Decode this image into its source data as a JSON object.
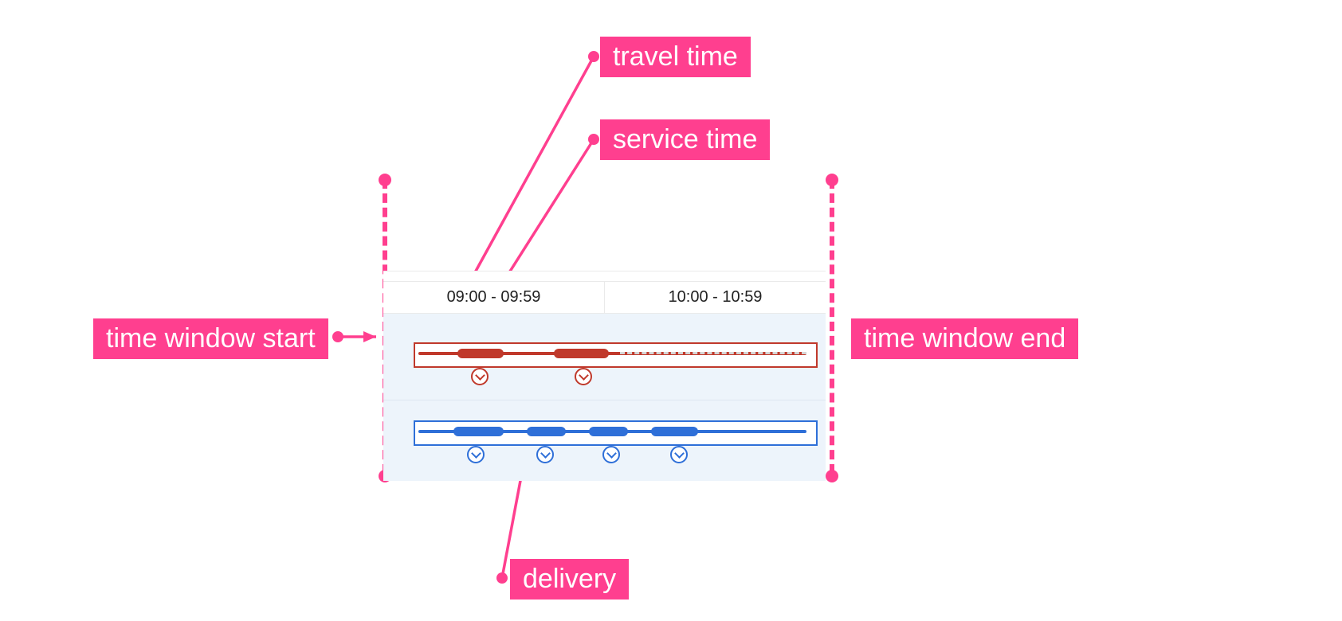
{
  "labels": {
    "travel_time": "travel time",
    "service_time": "service time",
    "time_window_start": "time window start",
    "time_window_end": "time window end",
    "delivery": "delivery"
  },
  "timeline": {
    "header": {
      "col1": "09:00 - 09:59",
      "col2": "10:00 - 10:59"
    }
  },
  "colors": {
    "pink": "#FF3F8F",
    "red": "#C0392B",
    "blue": "#2E6FD8",
    "pale": "#EDF4FB"
  },
  "diagram": {
    "description": "Annotated route timeline (Gantt-style) showing two vehicle rows. Thin line = travel time, thick segment = service time, circled chevron = delivery stop. Left/right dashed pink verticals mark time-window bounds.",
    "time_window": {
      "start_x_pct": 0,
      "end_x_pct": 100
    },
    "rows": [
      {
        "color": "red",
        "segments": [
          {
            "type": "travel",
            "start_pct": 0,
            "end_pct": 10
          },
          {
            "type": "service",
            "start_pct": 10,
            "end_pct": 22
          },
          {
            "type": "travel",
            "start_pct": 22,
            "end_pct": 35
          },
          {
            "type": "service",
            "start_pct": 35,
            "end_pct": 49
          }
        ],
        "stops_pct": [
          16,
          42
        ]
      },
      {
        "color": "blue",
        "segments": [
          {
            "type": "travel",
            "start_pct": 0,
            "end_pct": 9
          },
          {
            "type": "service",
            "start_pct": 9,
            "end_pct": 22
          },
          {
            "type": "travel",
            "start_pct": 22,
            "end_pct": 28
          },
          {
            "type": "service",
            "start_pct": 28,
            "end_pct": 38
          },
          {
            "type": "travel",
            "start_pct": 38,
            "end_pct": 44
          },
          {
            "type": "service",
            "start_pct": 44,
            "end_pct": 54
          },
          {
            "type": "travel",
            "start_pct": 54,
            "end_pct": 60
          },
          {
            "type": "service",
            "start_pct": 60,
            "end_pct": 72
          }
        ],
        "stops_pct": [
          15,
          32,
          48,
          66
        ]
      }
    ]
  }
}
